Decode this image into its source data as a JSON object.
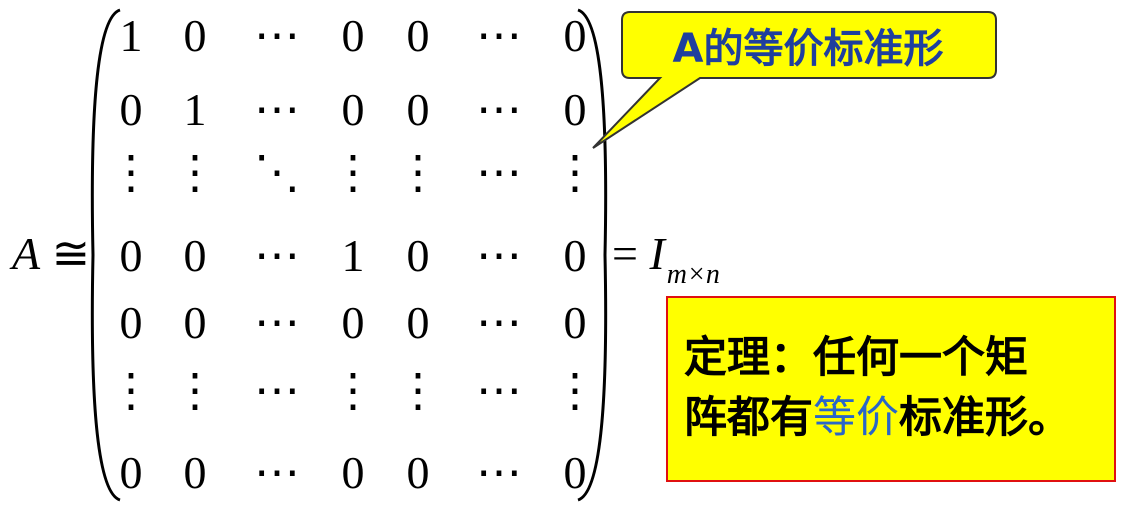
{
  "lhs": {
    "var": "A",
    "rel": "≅"
  },
  "matrix_rows": [
    [
      "1",
      "0",
      "⋯",
      "0",
      "0",
      "⋯",
      "0"
    ],
    [
      "0",
      "1",
      "⋯",
      "0",
      "0",
      "⋯",
      "0"
    ],
    [
      "⋮",
      "⋮",
      "⋱",
      "⋮",
      "⋮",
      "⋯",
      "⋮"
    ],
    [
      "0",
      "0",
      "⋯",
      "1",
      "0",
      "⋯",
      "0"
    ],
    [
      "0",
      "0",
      "⋯",
      "0",
      "0",
      "⋯",
      "0"
    ],
    [
      "⋮",
      "⋮",
      "⋯",
      "⋮",
      "⋮",
      "⋯",
      "⋮"
    ],
    [
      "0",
      "0",
      "⋯",
      "0",
      "0",
      "⋯",
      "0"
    ]
  ],
  "rhs": {
    "eq": "=",
    "var": "I",
    "sub": "m×n"
  },
  "callout": {
    "text": "A的等价标准形",
    "fill": "#ffff00",
    "stroke": "#333333",
    "text_color": "#1f3f9e"
  },
  "theorem": {
    "line1": "定理：任何一个矩",
    "line2_a": "阵都有",
    "line2_b": "等价",
    "line2_c": "标准形。",
    "fill": "#ffff00",
    "border": "#e01010",
    "highlight": "#2a66c8"
  }
}
